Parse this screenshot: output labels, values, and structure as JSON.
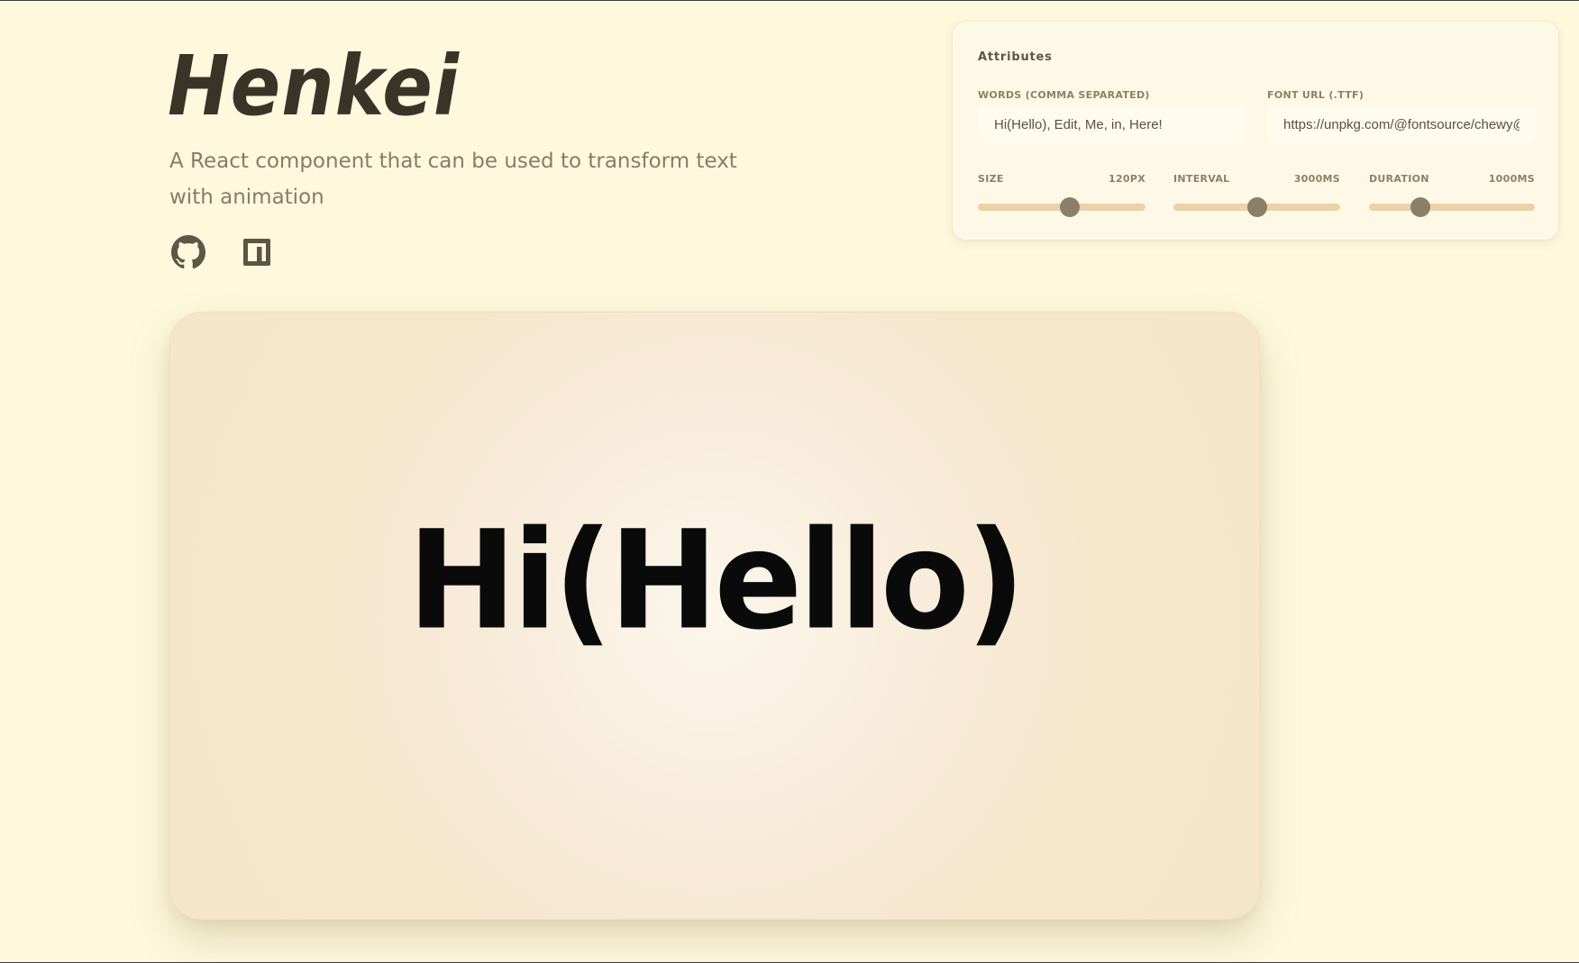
{
  "header": {
    "title": "Henkei",
    "subtitle": "A React component that can be used to transform text with animation",
    "links": [
      {
        "icon": "github-icon"
      },
      {
        "icon": "npm-icon"
      }
    ]
  },
  "attributes": {
    "title": "Attributes",
    "words": {
      "label": "WORDS (COMMA SEPARATED)",
      "value": "Hi(Hello), Edit, Me, in, Here!"
    },
    "font_url": {
      "label": "FONT URL (.TTF)",
      "value": "https://unpkg.com/@fontsource/chewy@"
    },
    "size": {
      "label": "SIZE",
      "value_label": "120PX",
      "fraction": 0.55
    },
    "interval": {
      "label": "INTERVAL",
      "value_label": "3000MS",
      "fraction": 0.5
    },
    "duration": {
      "label": "DURATION",
      "value_label": "1000MS",
      "fraction": 0.31
    }
  },
  "preview": {
    "text": "Hi(Hello)"
  },
  "colors": {
    "background": "#fef8dd",
    "panel": "#fef9e6",
    "track": "#ecd2a6",
    "thumb": "#8b7f6a",
    "title": "#3a3428",
    "subtitle": "#8a7c68"
  }
}
